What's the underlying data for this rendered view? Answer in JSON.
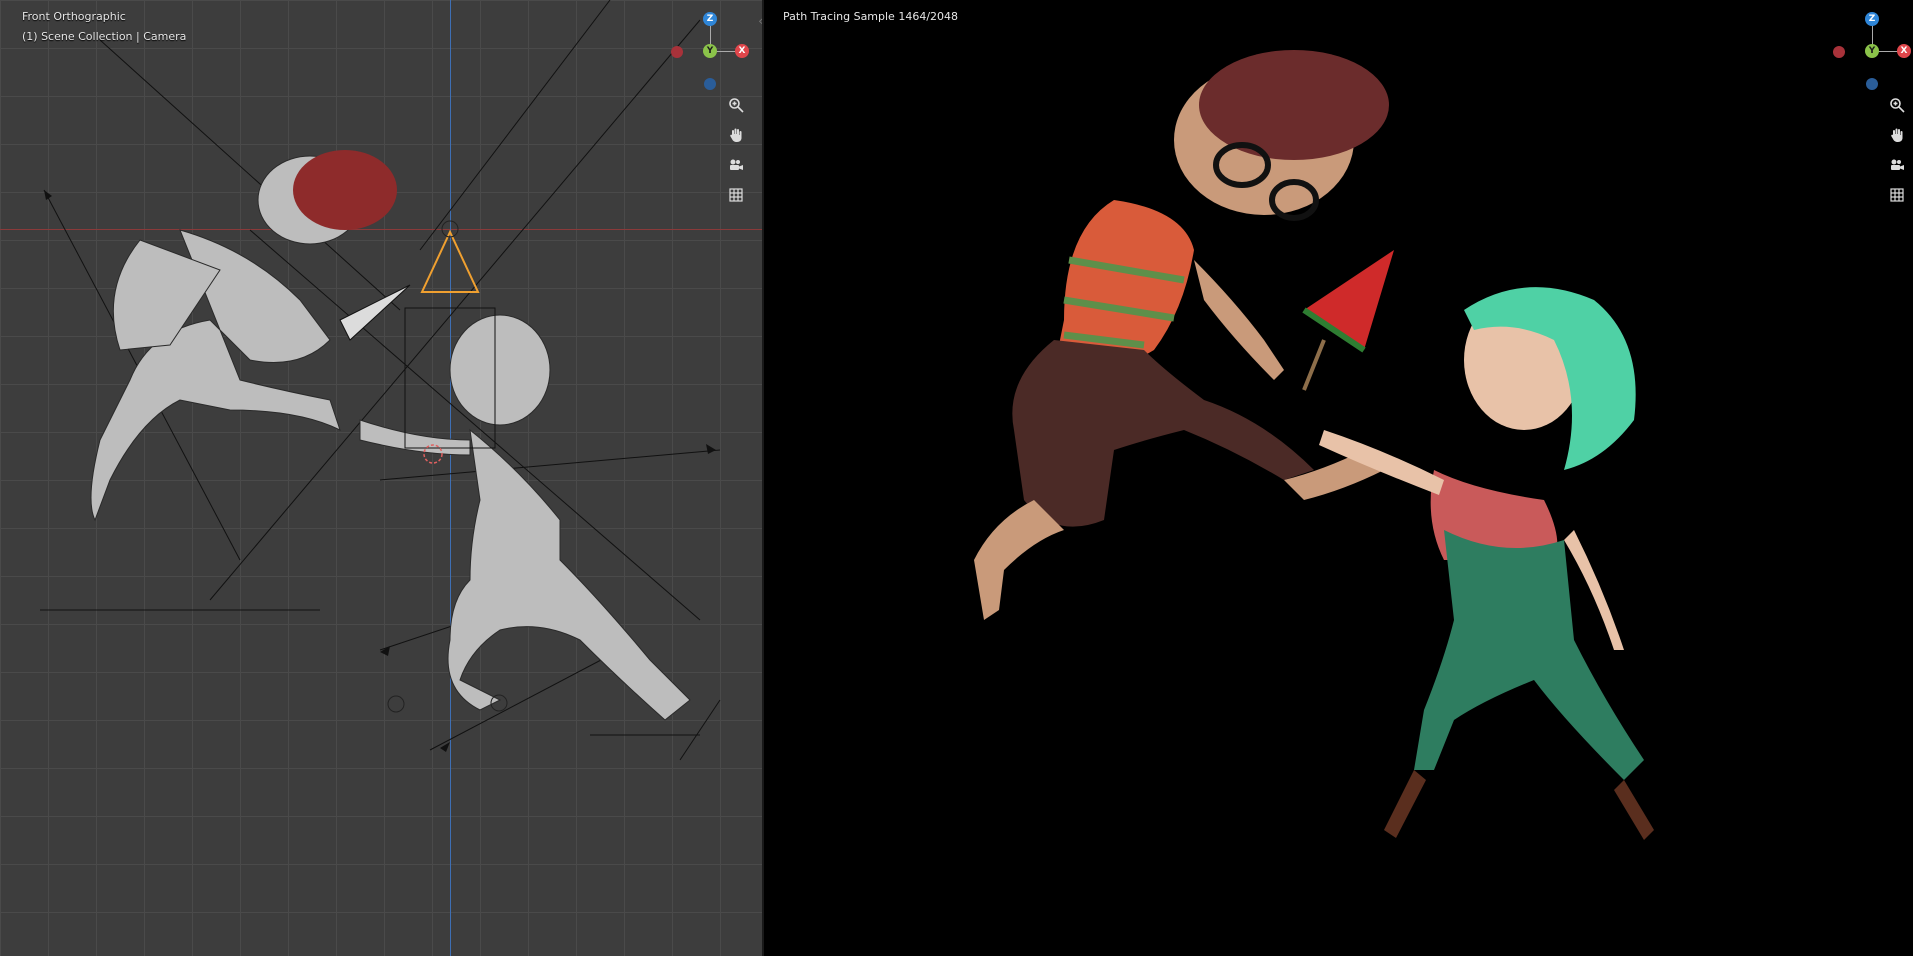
{
  "left_viewport": {
    "view_name": "Front Orthographic",
    "collection_info": "(1) Scene Collection | Camera"
  },
  "right_viewport": {
    "render_status": "Path Tracing Sample 1464/2048"
  },
  "gizmo": {
    "z_label": "Z",
    "y_label": "Y",
    "x_label": "X",
    "z_color": "#2f86d8",
    "y_color": "#8bc34a",
    "x_color": "#e0464b"
  },
  "tools": [
    "zoom-icon",
    "hand-pan-icon",
    "camera-icon",
    "grid-icon"
  ],
  "colors": {
    "viewport_bg": "#3d3d3d",
    "render_bg": "#000000",
    "x_axis": "#8a3a3a",
    "z_axis": "#3e6fb4"
  }
}
